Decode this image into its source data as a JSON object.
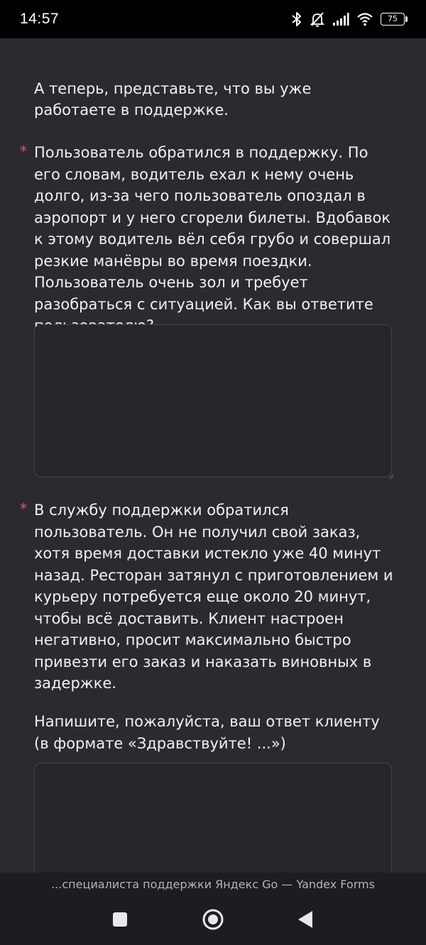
{
  "status_bar": {
    "time": "14:57",
    "battery": "75",
    "icons": [
      "bluetooth-icon",
      "bell-off-icon",
      "signal-icon",
      "wifi-icon",
      "battery-icon"
    ]
  },
  "form": {
    "intro": "А теперь, представьте, что вы уже работаете в поддержке.",
    "questions": [
      {
        "required_mark": "*",
        "text": "Пользователь обратился в поддержку. По его словам, водитель ехал к нему очень долго, из-за чего пользователь опоздал в аэропорт и у него сгорели билеты. Вдобавок к этому водитель вёл себя грубо и совершал резкие манёвры во время поездки. Пользователь очень зол и требует разобраться с ситуацией. Как вы ответите пользователю?",
        "answer": ""
      },
      {
        "required_mark": "*",
        "text": "В службу поддержки обратился пользователь. Он не получил свой заказ, хотя время доставки истекло уже 40 минут назад. Ресторан затянул с приготовлением и курьеру потребуется еще около 20 минут, чтобы всё доставить. Клиент настроен негативно, просит максимально быстро привезти его заказ и наказать виновных в задержке.",
        "subtext": "Напишите, пожалуйста, ваш ответ клиенту (в формате «Здравствуйте! ...»)",
        "answer": ""
      }
    ]
  },
  "browser": {
    "page_title": "...специалиста поддержки Яндекс Go — Yandex Forms"
  },
  "nav_bar": {
    "buttons": [
      "square-icon",
      "circle-icon",
      "triangle-back-icon"
    ]
  },
  "colors": {
    "background": "#2b2a30",
    "required_mark": "#e05a5a",
    "field_border": "#46454c"
  }
}
